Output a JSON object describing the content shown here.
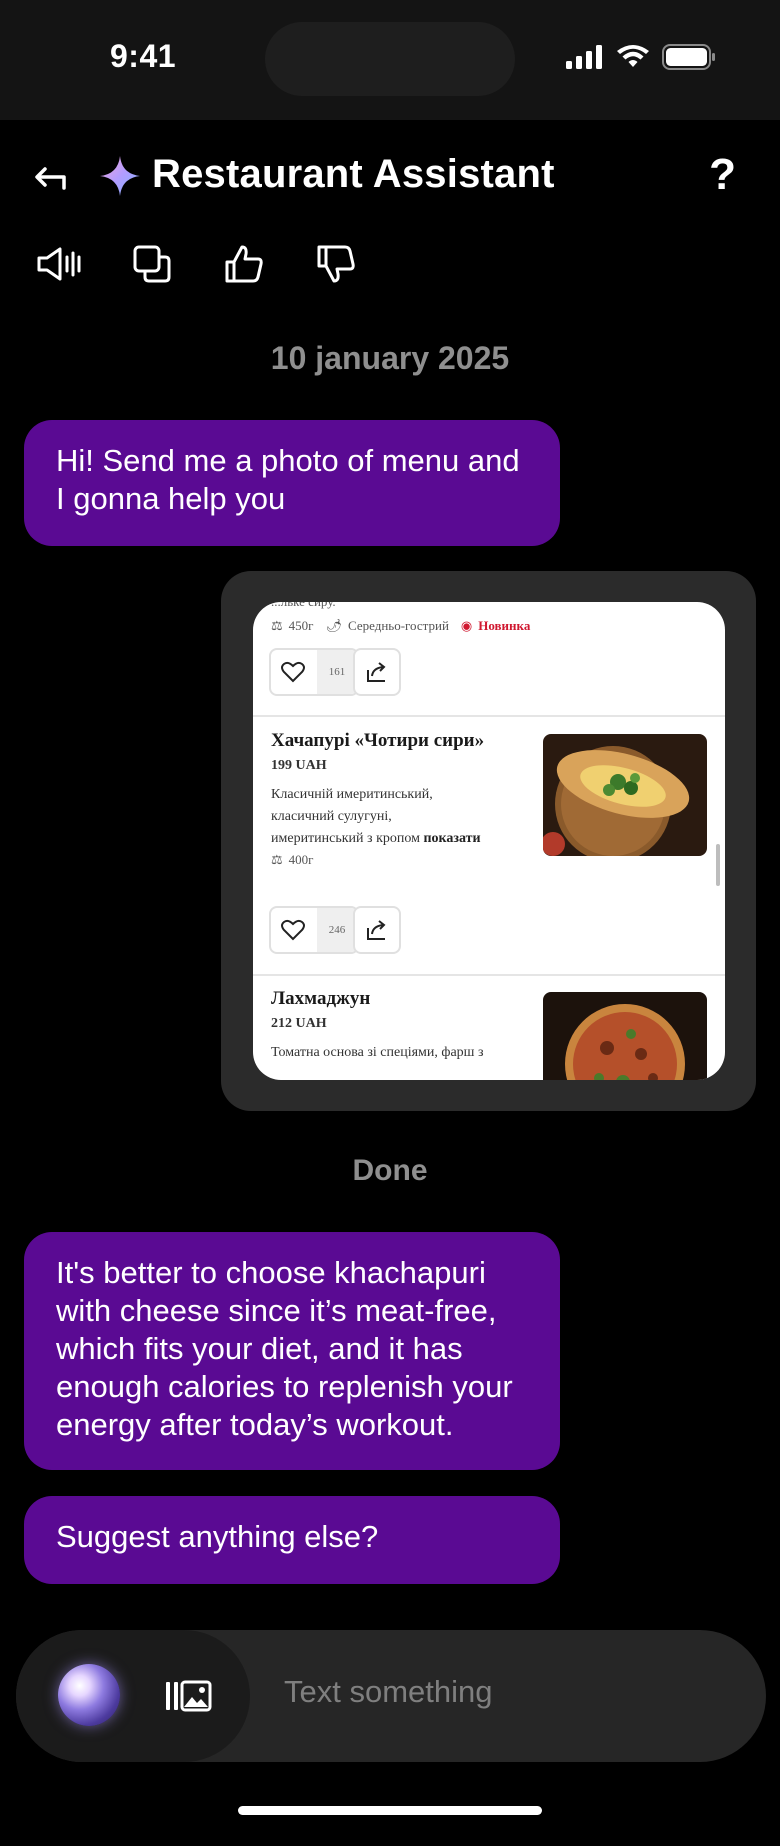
{
  "status_bar": {
    "time": "9:41"
  },
  "header": {
    "title": "Restaurant Assistant",
    "help_label": "?"
  },
  "chat": {
    "date": "10 january 2025",
    "messages": [
      {
        "role": "assistant",
        "text": "Hi! Send me a photo of menu and I gonna help you"
      },
      {
        "role": "assistant",
        "text": "It's better to choose khachapuri with cheese since it’s meat-free, which fits your diet, and it has enough calories to replenish your energy after today’s workout."
      },
      {
        "role": "assistant",
        "text": "Suggest anything else?"
      }
    ],
    "done_label": "Done"
  },
  "menu_image": {
    "top_cut_text": "...льке сиру.",
    "item0": {
      "weight": "450г",
      "spicy": "Середньо-гострий",
      "badge": "Новинка",
      "likes": "161"
    },
    "item1": {
      "name": "Хачапурі «Чотири сири»",
      "price": "199 UAH",
      "desc_lines": [
        "Класичній имеритинський,",
        "класичний сулугуні,",
        "имеритинський з кропом"
      ],
      "show_more": "показати",
      "weight": "400г",
      "likes": "246"
    },
    "item2": {
      "name": "Лахмаджун",
      "price": "212 UAH",
      "desc": "Томатна основа зі спеціями, фарш з"
    }
  },
  "input": {
    "placeholder": "Text something"
  }
}
